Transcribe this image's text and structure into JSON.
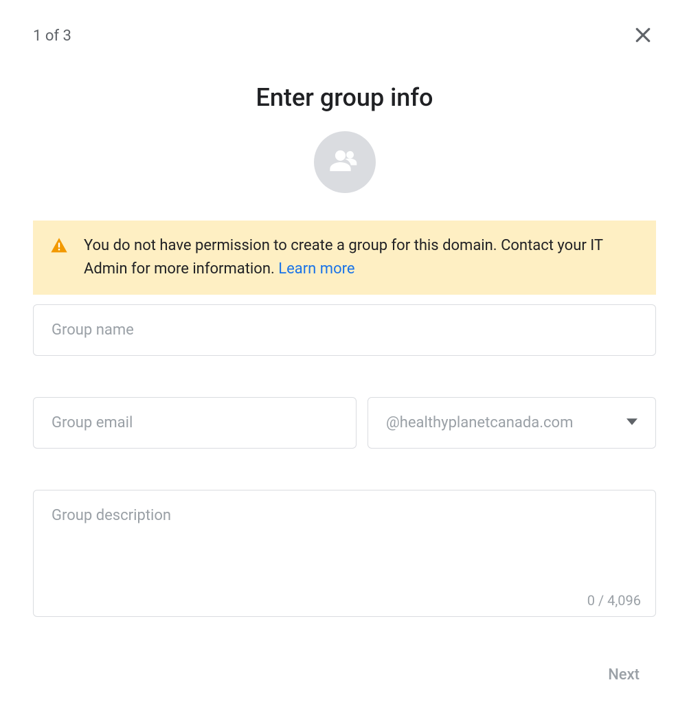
{
  "step_indicator": "1 of 3",
  "page_title": "Enter group info",
  "warning": {
    "message": "You do not have permission to create a group for this domain. Contact your IT Admin for more information. ",
    "link_text": "Learn more"
  },
  "fields": {
    "group_name_placeholder": "Group name",
    "group_email_placeholder": "Group email",
    "domain": "@healthyplanetcanada.com",
    "group_description_placeholder": "Group description"
  },
  "char_counter": "0 / 4,096",
  "next_button": "Next"
}
